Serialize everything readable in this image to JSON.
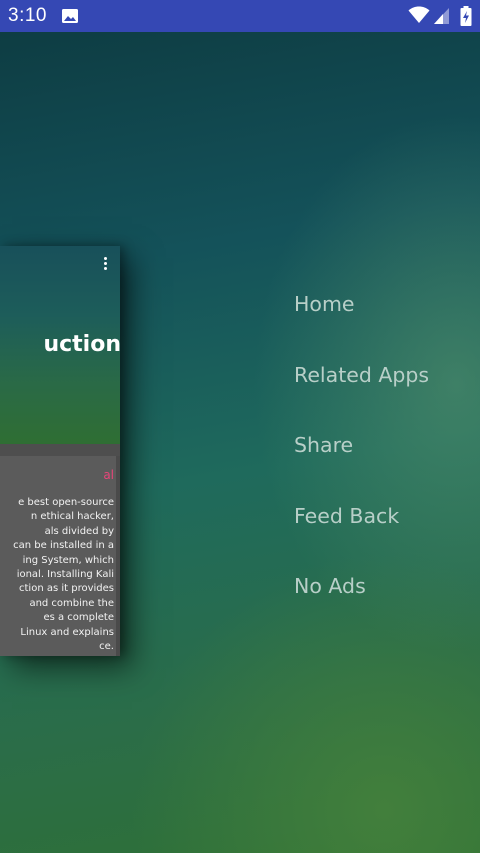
{
  "status_bar": {
    "time": "3:10",
    "icons": [
      "image-icon",
      "wifi-icon",
      "cellular-signal-icon",
      "battery-charging-icon"
    ]
  },
  "card": {
    "title": "uction",
    "subtitle": "al",
    "body_lines": [
      "e best open-source",
      "n ethical hacker,",
      "als divided by",
      "can be installed in a",
      "ing System, which",
      "ional. Installing Kali",
      "ction as it provides",
      "and combine the",
      "es a complete",
      "Linux and explains",
      "ce."
    ]
  },
  "menu": {
    "items": [
      "Home",
      "Related Apps",
      "Share",
      "Feed Back",
      "No Ads"
    ]
  },
  "colors": {
    "status_bar": "#3548b4",
    "menu_text": "#b8cfc8",
    "card_subtitle": "#e8457a",
    "card_body": "#5b5b5b"
  }
}
